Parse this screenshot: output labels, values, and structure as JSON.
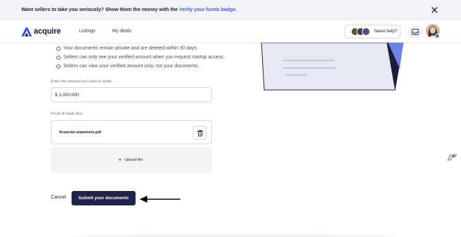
{
  "banner": {
    "text": "Want sellers to take you seriously? Show them the money with the ",
    "link_text": "Verify your funds badge."
  },
  "nav": {
    "brand": "acquire",
    "links": [
      "Listings",
      "My deals"
    ],
    "help_label": "Need help?"
  },
  "bullets": [
    "Your documents remain private and are deleted within 30 days.",
    "Sellers can only see your verified amount when you request startup access.",
    "Sellers can view your verified amount only, not your documents."
  ],
  "amount": {
    "label": "Enter the amount you want to verify",
    "value": "$ 1,000,000"
  },
  "files": {
    "label": "Proof of funds files",
    "items": [
      "financial-statement.pdf"
    ],
    "upload_label": "Upload file"
  },
  "actions": {
    "cancel": "Cancel",
    "submit": "Submit your documents"
  },
  "colors": {
    "accent": "#3f53d9",
    "primary_button": "#20224a",
    "banner_bg": "#f2f3f8"
  }
}
